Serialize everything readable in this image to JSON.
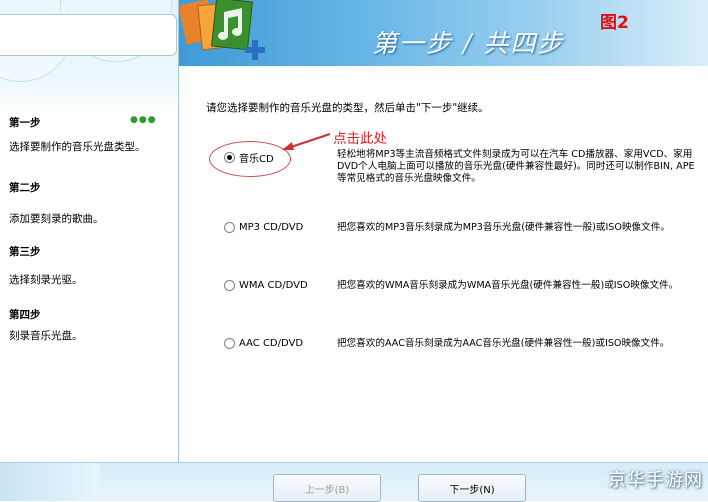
{
  "header": {
    "title": "第一步 / 共四步",
    "figure_label": "图2"
  },
  "sidebar": {
    "dots": "●●●",
    "steps": [
      {
        "title": "第一步",
        "desc": "选择要制作的音乐光盘类型。"
      },
      {
        "title": "第二步",
        "desc": "添加要刻录的歌曲。"
      },
      {
        "title": "第三步",
        "desc": "选择刻录光驱。"
      },
      {
        "title": "第四步",
        "desc": "刻录音乐光盘。"
      }
    ]
  },
  "main": {
    "instruction": "请您选择要制作的音乐光盘的类型，然后单击\"下一步\"继续。",
    "annotation": "点击此处",
    "options": [
      {
        "label": "音乐CD",
        "checked": true,
        "desc": "轻松地将MP3等主流音频格式文件刻录成为可以在汽车 CD播放器、家用VCD、家用DVD个人电脑上面可以播放的音乐光盘(硬件兼容性最好)。同时还可以制作BIN, APE等常见格式的音乐光盘映像文件。"
      },
      {
        "label": "MP3 CD/DVD",
        "checked": false,
        "desc": "把您喜欢的MP3音乐刻录成为MP3音乐光盘(硬件兼容性一般)或ISO映像文件。"
      },
      {
        "label": "WMA CD/DVD",
        "checked": false,
        "desc": "把您喜欢的WMA音乐刻录成为WMA音乐光盘(硬件兼容性一般)或ISO映像文件。"
      },
      {
        "label": "AAC CD/DVD",
        "checked": false,
        "desc": "把您喜欢的AAC音乐刻录成为AAC音乐光盘(硬件兼容性一般)或ISO映像文件。"
      }
    ]
  },
  "footer": {
    "prev_label": "上一步(B)",
    "next_label": "下一步(N)",
    "watermark": "京华手游网"
  },
  "colors": {
    "header_accent": "#3f9ad6",
    "annotation_red": "#e02020"
  }
}
